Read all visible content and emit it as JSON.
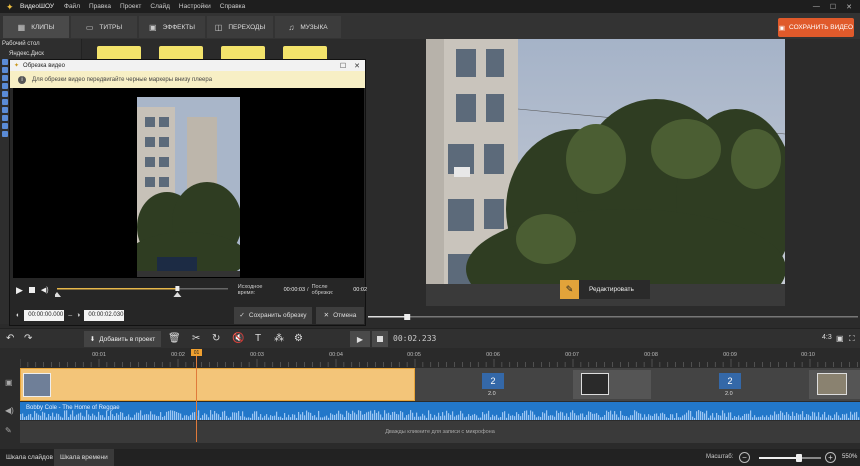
{
  "menu": {
    "app_title": "ВидеоШОУ",
    "items": [
      "Файл",
      "Правка",
      "Проект",
      "Слайд",
      "Настройки",
      "Справка"
    ]
  },
  "tabs": [
    {
      "label": "КЛИПЫ",
      "icon": "clips-icon",
      "active": true
    },
    {
      "label": "ТИТРЫ",
      "icon": "titles-icon",
      "active": false
    },
    {
      "label": "ЭФФЕКТЫ",
      "icon": "effects-icon",
      "active": false
    },
    {
      "label": "ПЕРЕХОДЫ",
      "icon": "transitions-icon",
      "active": false
    },
    {
      "label": "МУЗЫКА",
      "icon": "music-icon",
      "active": false
    }
  ],
  "save_video_label": "СОХРАНИТЬ ВИДЕО",
  "library": {
    "items": [
      "Рабочий стол",
      "Яндекс.Диск"
    ]
  },
  "trim_dialog": {
    "title": "Обрезка видео",
    "hint": "Для обрезки видео передвигайте черные маркеры внизу плеера",
    "source_time_label": "Исходное время:",
    "source_time": "00:00:03",
    "after_trim_label": "После обрезки:",
    "after_trim": "00:02",
    "start_time": "00:00:00.000",
    "end_time": "00:00:02.030",
    "save_trim_label": "Сохранить обрезку",
    "cancel_label": "Отмена",
    "trim_start_fraction": 0.0,
    "trim_end_fraction": 0.7
  },
  "preview": {
    "edit_label": "Редактировать",
    "progress_fraction": 0.08
  },
  "toolbar": {
    "add_to_project_label": "Добавить в проект",
    "timecode": "00:02.233",
    "aspect_ratio": "4:3"
  },
  "timeline": {
    "ticks": [
      "00:01",
      "00:02",
      "00:03",
      "00:04",
      "00:05",
      "00:06",
      "00:07",
      "00:08",
      "00:09",
      "00:10"
    ],
    "playhead_label": "01",
    "transitions": [
      "2.0",
      "2.0"
    ],
    "audio_label": "Bobby Cole - The Home of Reggae",
    "mic_hint": "Дважды кликните для записи с микрофона"
  },
  "bottom": {
    "tab_slides": "Шкала слайдов",
    "tab_timeline": "Шкала времени",
    "scale_label": "Масштаб:",
    "zoom_value": "550%",
    "zoom_fraction": 0.65
  },
  "colors": {
    "accent_orange": "#e05a2b",
    "clip_selected": "#f3c579",
    "audio_track": "#2277c9",
    "playhead": "#e07a3a"
  }
}
